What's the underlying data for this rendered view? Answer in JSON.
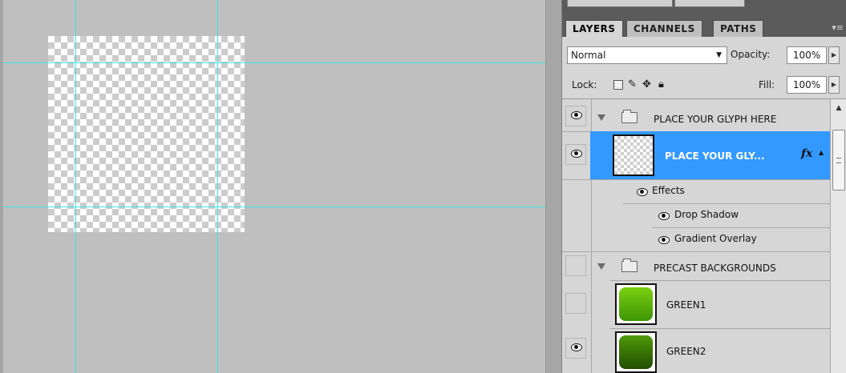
{
  "canvas": {
    "background_color": "#bfbfbf",
    "guide_color": "#41e3e8"
  },
  "panel": {
    "tabs": [
      {
        "label": "LAYERS",
        "active": true
      },
      {
        "label": "CHANNELS",
        "active": false
      },
      {
        "label": "PATHS",
        "active": false
      }
    ],
    "menu_icon": "panel-menu-icon",
    "blend_mode": "Normal",
    "opacity_label": "Opacity:",
    "opacity_value": "100%",
    "lock_label": "Lock:",
    "fill_label": "Fill:",
    "fill_value": "100%"
  },
  "layers": {
    "group1": {
      "name": "PLACE YOUR GLYPH HERE",
      "visible": true,
      "expanded": true
    },
    "selected_layer": {
      "name": "PLACE YOUR GLY...",
      "fx": "fx",
      "visible": true,
      "selected_color": "#3399ff"
    },
    "effects_label": "Effects",
    "effects": [
      "Drop Shadow",
      "Gradient Overlay"
    ],
    "group2": {
      "name": "PRECAST BACKGROUNDS",
      "visible": false,
      "expanded": true
    },
    "green1": {
      "name": "GREEN1",
      "visible": false,
      "color": "#5cb20a"
    },
    "green2": {
      "name": "GREEN2",
      "visible": true,
      "color": "#3d7a06"
    }
  }
}
